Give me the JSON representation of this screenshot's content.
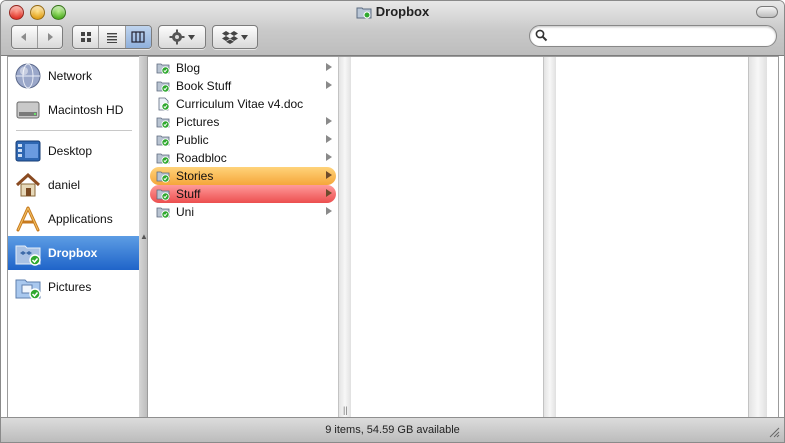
{
  "window": {
    "title": "Dropbox",
    "title_icon": "dropbox-folder-icon"
  },
  "toolbar": {
    "back_icon": "back-arrow-icon",
    "forward_icon": "forward-arrow-icon",
    "view_modes": [
      "icon-view",
      "list-view",
      "column-view"
    ],
    "active_view": "column-view",
    "action_icon": "gear-icon",
    "dropbox_icon": "dropbox-icon",
    "search_placeholder": ""
  },
  "sidebar": {
    "devices": [
      {
        "label": "Network",
        "icon": "network-globe-icon"
      },
      {
        "label": "Macintosh HD",
        "icon": "hard-drive-icon"
      }
    ],
    "places": [
      {
        "label": "Desktop",
        "icon": "desktop-icon"
      },
      {
        "label": "daniel",
        "icon": "home-icon"
      },
      {
        "label": "Applications",
        "icon": "applications-icon"
      },
      {
        "label": "Dropbox",
        "icon": "dropbox-folder-icon",
        "selected": true
      },
      {
        "label": "Pictures",
        "icon": "pictures-folder-icon"
      }
    ]
  },
  "column1": {
    "items": [
      {
        "label": "Blog",
        "type": "folder",
        "color_label": ""
      },
      {
        "label": "Book Stuff",
        "type": "folder",
        "color_label": ""
      },
      {
        "label": "Curriculum Vitae v4.doc",
        "type": "file",
        "color_label": ""
      },
      {
        "label": "Pictures",
        "type": "folder",
        "color_label": ""
      },
      {
        "label": "Public",
        "type": "folder",
        "color_label": ""
      },
      {
        "label": "Roadbloc",
        "type": "folder",
        "color_label": ""
      },
      {
        "label": "Stories",
        "type": "folder",
        "color_label": "orange"
      },
      {
        "label": "Stuff",
        "type": "folder",
        "color_label": "red"
      },
      {
        "label": "Uni",
        "type": "folder",
        "color_label": ""
      }
    ]
  },
  "status": {
    "text": "9 items, 54.59 GB available"
  },
  "colors": {
    "selection": "#2a6fd0",
    "label_orange": "#f5a63a",
    "label_red": "#ec4f4f",
    "sync_green": "#2fa82f"
  }
}
